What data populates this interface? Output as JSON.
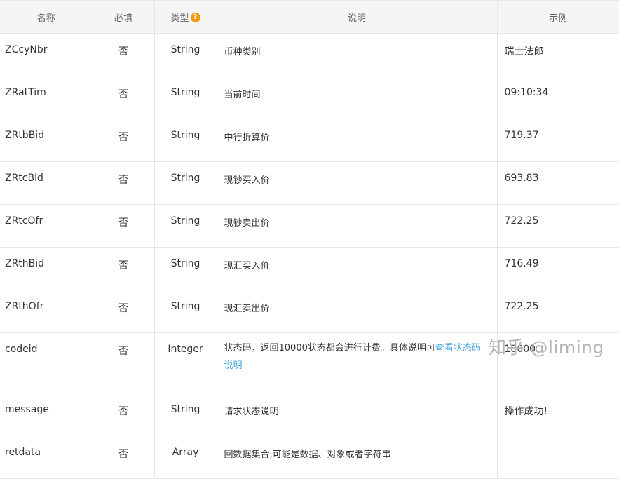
{
  "table": {
    "headers": {
      "name": "名称",
      "required": "必填",
      "type": "类型",
      "type_help_icon": "?",
      "description": "说明",
      "example": "示例"
    },
    "rows": [
      {
        "name": "ZCcyNbr",
        "required": "否",
        "type": "String",
        "description": "币种类别",
        "example": "瑞士法郎"
      },
      {
        "name": "ZRatTim",
        "required": "否",
        "type": "String",
        "description": "当前时间",
        "example": "09:10:34"
      },
      {
        "name": "ZRtbBid",
        "required": "否",
        "type": "String",
        "description": "中行折算价",
        "example": "719.37"
      },
      {
        "name": "ZRtcBid",
        "required": "否",
        "type": "String",
        "description": "现钞买入价",
        "example": "693.83"
      },
      {
        "name": "ZRtcOfr",
        "required": "否",
        "type": "String",
        "description": "现钞卖出价",
        "example": "722.25"
      },
      {
        "name": "ZRthBid",
        "required": "否",
        "type": "String",
        "description": "现汇买入价",
        "example": "716.49"
      },
      {
        "name": "ZRthOfr",
        "required": "否",
        "type": "String",
        "description": "现汇卖出价",
        "example": "722.25"
      },
      {
        "name": "codeid",
        "required": "否",
        "type": "Integer",
        "description": "状态码，返回10000状态都会进行计费。具体说明可",
        "description_link": "查看状态码说明",
        "example": "10000"
      },
      {
        "name": "message",
        "required": "否",
        "type": "String",
        "description": "请求状态说明",
        "example": "操作成功!"
      },
      {
        "name": "retdata",
        "required": "否",
        "type": "Array",
        "description": "回数据集合,可能是数据、对象或者字符串",
        "example": ""
      }
    ]
  },
  "watermark": "知乎 @liming",
  "colors": {
    "header_bg": "#f5f5f5",
    "border": "#e6e6e6",
    "link": "#3fa3d8",
    "help_icon": "#f39c12"
  }
}
